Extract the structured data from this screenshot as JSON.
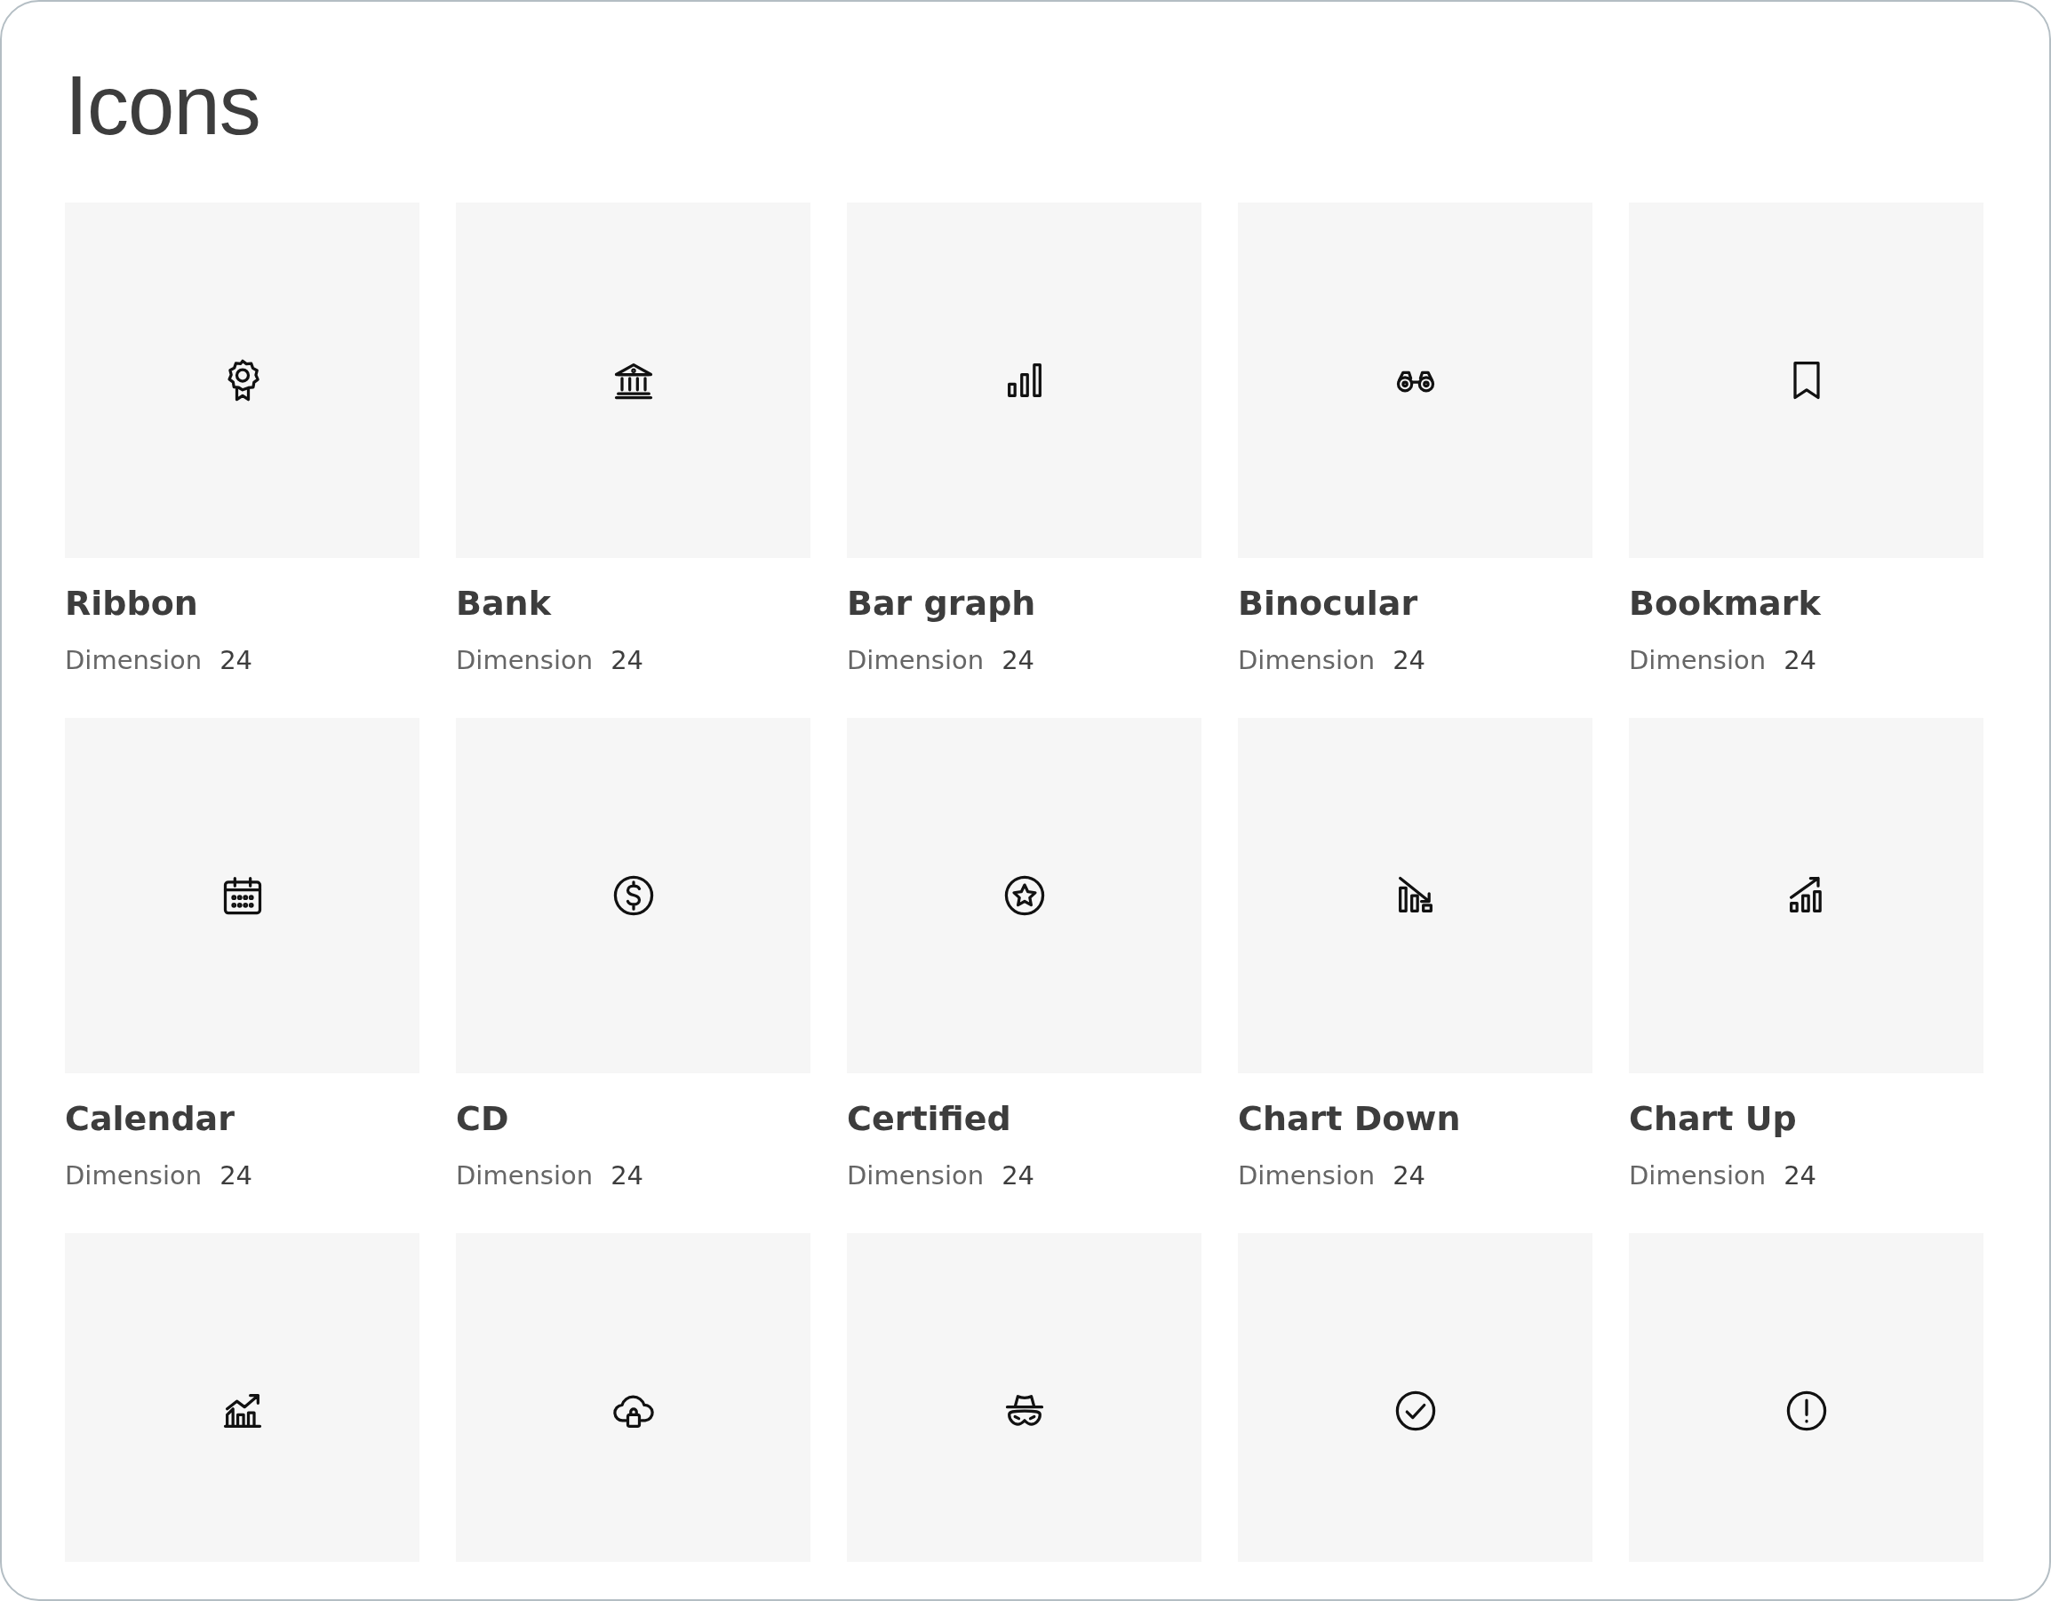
{
  "title": "Icons",
  "items": [
    {
      "kind": "ribbon",
      "name": "Ribbon",
      "dimension_label": "Dimension",
      "dimension_value": "24"
    },
    {
      "kind": "bank",
      "name": "Bank",
      "dimension_label": "Dimension",
      "dimension_value": "24"
    },
    {
      "kind": "bar-graph",
      "name": "Bar graph",
      "dimension_label": "Dimension",
      "dimension_value": "24"
    },
    {
      "kind": "binocular",
      "name": "Binocular",
      "dimension_label": "Dimension",
      "dimension_value": "24"
    },
    {
      "kind": "bookmark",
      "name": "Bookmark",
      "dimension_label": "Dimension",
      "dimension_value": "24"
    },
    {
      "kind": "calendar",
      "name": "Calendar",
      "dimension_label": "Dimension",
      "dimension_value": "24"
    },
    {
      "kind": "dollar-coin",
      "name": "CD",
      "dimension_label": "Dimension",
      "dimension_value": "24"
    },
    {
      "kind": "star-circle",
      "name": "Certified",
      "dimension_label": "Dimension",
      "dimension_value": "24"
    },
    {
      "kind": "chart-down",
      "name": "Chart Down",
      "dimension_label": "Dimension",
      "dimension_value": "24"
    },
    {
      "kind": "chart-up",
      "name": "Chart Up",
      "dimension_label": "Dimension",
      "dimension_value": "24"
    },
    {
      "kind": "growth-chart"
    },
    {
      "kind": "cloud-lock"
    },
    {
      "kind": "incognito"
    },
    {
      "kind": "check-circle"
    },
    {
      "kind": "alert-circle"
    }
  ]
}
